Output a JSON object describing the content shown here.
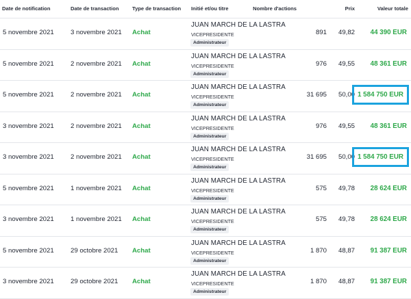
{
  "headers": {
    "notification_date": "Date de notification",
    "transaction_date": "Date de transaction",
    "transaction_type": "Type de transaction",
    "insider": "Initié et/ou titre",
    "shares": "Nombre d'actions",
    "price": "Prix",
    "total": "Valeur totale"
  },
  "rows": [
    {
      "notif": "5 novembre 2021",
      "trans": "3 novembre 2021",
      "type": "Achat",
      "name": "JUAN MARCH DE LA LASTRA",
      "role": "VICEPRESIDENTE",
      "badge": "Administrateur",
      "shares": "891",
      "price": "49,82",
      "total": "44 390 EUR",
      "highlighted": false
    },
    {
      "notif": "5 novembre 2021",
      "trans": "2 novembre 2021",
      "type": "Achat",
      "name": "JUAN MARCH DE LA LASTRA",
      "role": "VICEPRESIDENTE",
      "badge": "Administrateur",
      "shares": "976",
      "price": "49,55",
      "total": "48 361 EUR",
      "highlighted": false
    },
    {
      "notif": "5 novembre 2021",
      "trans": "2 novembre 2021",
      "type": "Achat",
      "name": "JUAN MARCH DE LA LASTRA",
      "role": "VICEPRESIDENTE",
      "badge": "Administrateur",
      "shares": "31 695",
      "price": "50,00",
      "total": "1 584 750 EUR",
      "highlighted": true
    },
    {
      "notif": "3 novembre 2021",
      "trans": "2 novembre 2021",
      "type": "Achat",
      "name": "JUAN MARCH DE LA LASTRA",
      "role": "VICEPRESIDENTE",
      "badge": "Administrateur",
      "shares": "976",
      "price": "49,55",
      "total": "48 361 EUR",
      "highlighted": false
    },
    {
      "notif": "3 novembre 2021",
      "trans": "2 novembre 2021",
      "type": "Achat",
      "name": "JUAN MARCH DE LA LASTRA",
      "role": "VICEPRESIDENTE",
      "badge": "Administrateur",
      "shares": "31 695",
      "price": "50,00",
      "total": "1 584 750 EUR",
      "highlighted": true
    },
    {
      "notif": "5 novembre 2021",
      "trans": "1 novembre 2021",
      "type": "Achat",
      "name": "JUAN MARCH DE LA LASTRA",
      "role": "VICEPRESIDENTE",
      "badge": "Administrateur",
      "shares": "575",
      "price": "49,78",
      "total": "28 624 EUR",
      "highlighted": false
    },
    {
      "notif": "3 novembre 2021",
      "trans": "1 novembre 2021",
      "type": "Achat",
      "name": "JUAN MARCH DE LA LASTRA",
      "role": "VICEPRESIDENTE",
      "badge": "Administrateur",
      "shares": "575",
      "price": "49,78",
      "total": "28 624 EUR",
      "highlighted": false
    },
    {
      "notif": "5 novembre 2021",
      "trans": "29 octobre 2021",
      "type": "Achat",
      "name": "JUAN MARCH DE LA LASTRA",
      "role": "VICEPRESIDENTE",
      "badge": "Administrateur",
      "shares": "1 870",
      "price": "48,87",
      "total": "91 387 EUR",
      "highlighted": false
    },
    {
      "notif": "3 novembre 2021",
      "trans": "29 octobre 2021",
      "type": "Achat",
      "name": "JUAN MARCH DE LA LASTRA",
      "role": "VICEPRESIDENTE",
      "badge": "Administrateur",
      "shares": "1 870",
      "price": "48,87",
      "total": "91 387 EUR",
      "highlighted": false
    }
  ],
  "colors": {
    "buy_green": "#2ea84a",
    "highlight_blue": "#1ba3de",
    "divider": "#e3e5ea"
  }
}
